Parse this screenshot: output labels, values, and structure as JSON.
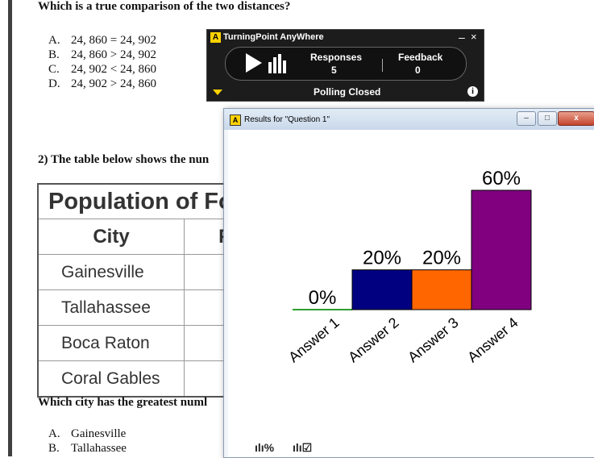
{
  "document": {
    "q1": {
      "question": "Which is a true comparison of the two distances?",
      "options": [
        {
          "letter": "A.",
          "text": "24, 860 = 24, 902"
        },
        {
          "letter": "B.",
          "text": "24, 860 > 24, 902"
        },
        {
          "letter": "C.",
          "text": "24, 902 < 24, 860"
        },
        {
          "letter": "D.",
          "text": "24, 902 > 24, 860"
        }
      ]
    },
    "q2": {
      "question": "2) The table below shows the nun",
      "table": {
        "title": "Population of Fo",
        "headers": [
          "City",
          "Po"
        ],
        "rows": [
          "Gainesville",
          "Tallahassee",
          "Boca Raton",
          "Coral Gables"
        ]
      }
    },
    "q3": {
      "question": "Which city has the greatest numl",
      "answers": [
        {
          "letter": "A.",
          "text": "Gainesville"
        },
        {
          "letter": "B.",
          "text": "Tallahassee"
        }
      ]
    }
  },
  "turningpoint": {
    "title": "TurningPoint AnyWhere",
    "logo": "A",
    "min_label": "–",
    "close_label": "×",
    "responses_label": "Responses",
    "responses_value": "5",
    "feedback_label": "Feedback",
    "feedback_value": "0",
    "status": "Polling Closed",
    "info_label": "i",
    "icons": [
      "play-icon",
      "bar-chart-icon",
      "dropdown-arrow-icon",
      "info-icon"
    ]
  },
  "results_window": {
    "title": "Results for \"Question 1\"",
    "logo": "A",
    "min_label": "–",
    "max_label": "□",
    "close_label": "x",
    "footer_icons": [
      "percent-chart-icon",
      "correct-chart-icon"
    ]
  },
  "chart_data": {
    "type": "bar",
    "categories": [
      "Answer 1",
      "Answer 2",
      "Answer 3",
      "Answer 4"
    ],
    "values": [
      0,
      20,
      20,
      60
    ],
    "labels": [
      "0%",
      "20%",
      "20%",
      "60%"
    ],
    "colors": [
      "#2e9e2e",
      "#000080",
      "#ff6600",
      "#800080"
    ],
    "title": "",
    "xlabel": "",
    "ylabel": "",
    "ylim": [
      0,
      60
    ],
    "grid": false,
    "legend": "none"
  }
}
